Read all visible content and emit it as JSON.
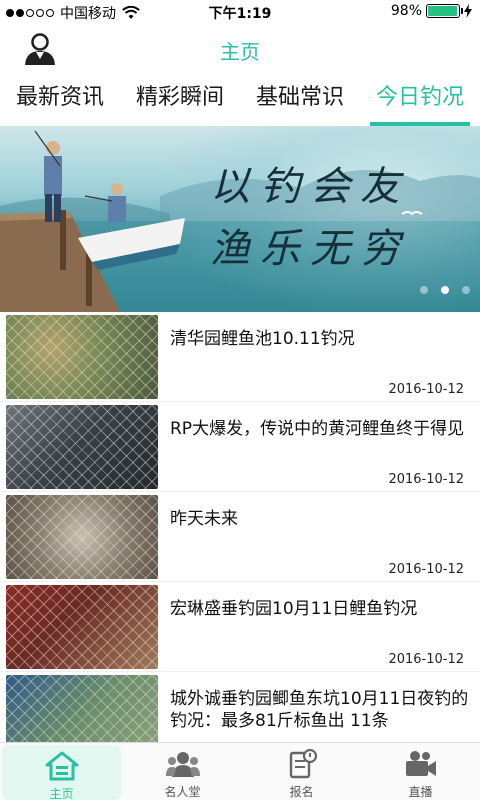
{
  "status_bar": {
    "carrier": "中国移动",
    "time": "下午1:19",
    "battery": "98%",
    "battery_level": 0.98
  },
  "nav": {
    "title": "主页"
  },
  "tabs": [
    {
      "label": "最新资讯",
      "active": false
    },
    {
      "label": "精彩瞬间",
      "active": false
    },
    {
      "label": "基础常识",
      "active": false
    },
    {
      "label": "今日钓况",
      "active": true
    }
  ],
  "banner": {
    "caption_line1": "以钓会友",
    "caption_line2": "渔乐无穷",
    "page_count": 3,
    "active_index": 1
  },
  "articles": [
    {
      "title": "清华园鲤鱼池10.11钓况",
      "date": "2016-10-12"
    },
    {
      "title": "RP大爆发，传说中的黄河鲤鱼终于得见",
      "date": "2016-10-12"
    },
    {
      "title": "昨天未来",
      "date": "2016-10-12"
    },
    {
      "title": "宏琳盛垂钓园10月11日鲤鱼钓况",
      "date": "2016-10-12"
    },
    {
      "title": "城外诚垂钓园鲫鱼东坑10月11日夜钓的钓况：最多81斤标鱼出 11条",
      "date": ""
    }
  ],
  "tabbar": [
    {
      "label": "主页",
      "icon": "home-icon",
      "active": true
    },
    {
      "label": "名人堂",
      "icon": "people-icon",
      "active": false
    },
    {
      "label": "报名",
      "icon": "signup-icon",
      "active": false
    },
    {
      "label": "直播",
      "icon": "video-camera-icon",
      "active": false
    }
  ],
  "colors": {
    "accent": "#26c2a0",
    "active_tab_bg": "#e3f7f1"
  }
}
